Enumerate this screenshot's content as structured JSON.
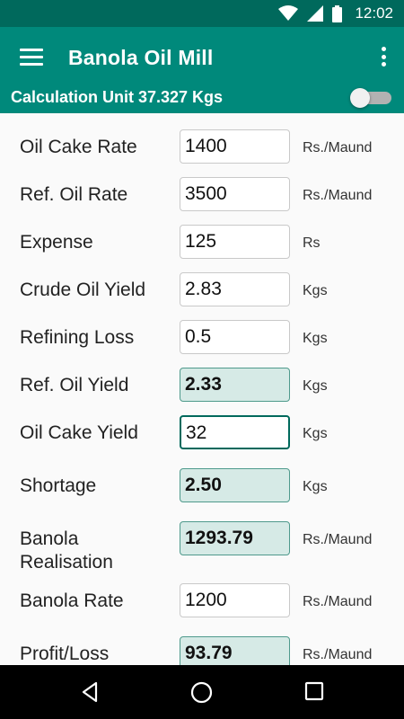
{
  "status_bar": {
    "time": "12:02",
    "icons": [
      "wifi-icon",
      "signal-icon",
      "battery-icon"
    ]
  },
  "app_bar": {
    "title": "Banola Oil Mill",
    "menu_icon": "menu-icon",
    "more_icon": "more-vert-icon"
  },
  "calc_unit": {
    "label": "Calculation Unit 37.327 Kgs",
    "toggle_on": false
  },
  "fields": [
    {
      "label": "Oil Cake Rate",
      "value": "1400",
      "unit": "Rs./Maund",
      "type": "input"
    },
    {
      "label": "Ref. Oil Rate",
      "value": "3500",
      "unit": "Rs./Maund",
      "type": "input"
    },
    {
      "label": "Expense",
      "value": "125",
      "unit": "Rs",
      "type": "input"
    },
    {
      "label": "Crude Oil Yield",
      "value": "2.83",
      "unit": "Kgs",
      "type": "input"
    },
    {
      "label": "Refining Loss",
      "value": "0.5",
      "unit": "Kgs",
      "type": "input"
    },
    {
      "label": "Ref. Oil Yield",
      "value": "2.33",
      "unit": "Kgs",
      "type": "calculated"
    },
    {
      "label": "Oil Cake Yield",
      "value": "32",
      "unit": "Kgs",
      "type": "input-focused"
    },
    {
      "label": "Shortage",
      "value": "2.50",
      "unit": "Kgs",
      "type": "calculated"
    },
    {
      "label": "Banola\nRealisation",
      "value": "1293.79",
      "unit": "Rs./Maund",
      "type": "calculated"
    },
    {
      "label": "Banola Rate",
      "value": "1200",
      "unit": "Rs./Maund",
      "type": "input"
    },
    {
      "label": "Profit/Loss",
      "value": "93.79",
      "unit": "Rs./Maund",
      "type": "calculated"
    }
  ],
  "nav_bar": {
    "buttons": [
      "back-icon",
      "home-icon",
      "recents-icon"
    ]
  },
  "colors": {
    "primary": "#00897b",
    "primary_dark": "#00695c",
    "calculated_bg": "#d6eae6"
  }
}
